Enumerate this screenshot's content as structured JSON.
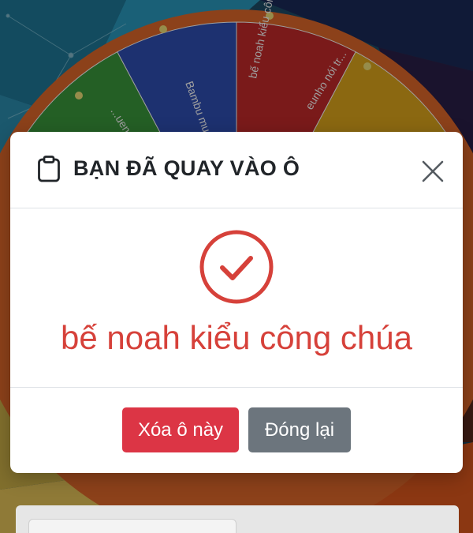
{
  "modal": {
    "title": "BẠN ĐÃ QUAY VÀO Ô",
    "result": "bế noah kiểu công chúa",
    "delete_label": "Xóa ô này",
    "close_label": "Đóng lại"
  },
  "wheel": {
    "segments": [
      {
        "label": "...uen bánh...",
        "color": "#3b9a3c"
      },
      {
        "label": "Bambu mua bán...",
        "color": "#2f4fb5"
      },
      {
        "label": "bế noah kiểu công...",
        "color": "#c62a2a"
      },
      {
        "label": "eunho nói tr...",
        "color": "#e0a81c"
      }
    ]
  },
  "colors": {
    "accent_red": "#d6413a",
    "danger": "#dc3545",
    "secondary": "#6c757d"
  },
  "icons": {
    "title_icon": "clipboard-icon",
    "close_icon": "close-icon",
    "success_icon": "check-circle-icon"
  }
}
